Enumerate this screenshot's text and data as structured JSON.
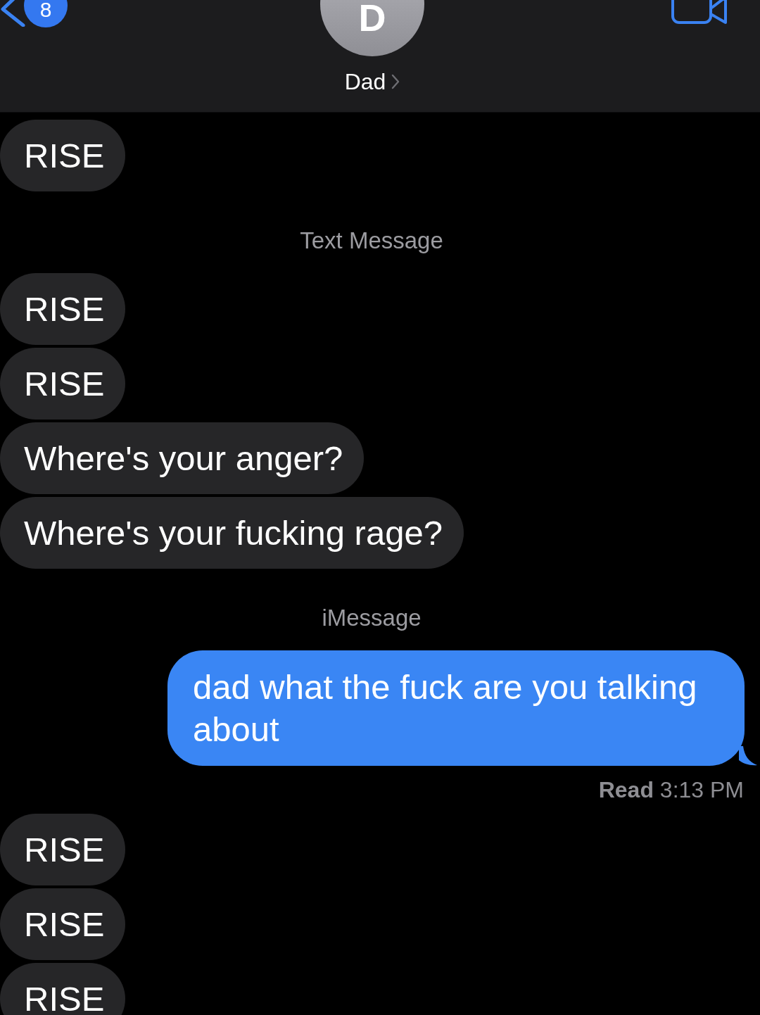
{
  "header": {
    "back_badge": "8",
    "avatar_initial": "D",
    "contact_name": "Dad"
  },
  "messages": [
    {
      "kind": "incoming",
      "text": "RISE"
    },
    {
      "kind": "label",
      "text": "Text Message"
    },
    {
      "kind": "incoming",
      "text": "RISE"
    },
    {
      "kind": "incoming",
      "text": "RISE"
    },
    {
      "kind": "incoming",
      "text": "Where's your anger?"
    },
    {
      "kind": "incoming",
      "text": "Where's your fucking rage?"
    },
    {
      "kind": "label",
      "text": "iMessage"
    },
    {
      "kind": "outgoing",
      "text": "dad what the fuck are you talking about"
    },
    {
      "kind": "receipt",
      "text": "**Read** 3:13 PM"
    },
    {
      "kind": "incoming",
      "text": "RISE"
    },
    {
      "kind": "incoming",
      "text": "RISE"
    },
    {
      "kind": "incoming",
      "text": "RISE"
    }
  ]
}
